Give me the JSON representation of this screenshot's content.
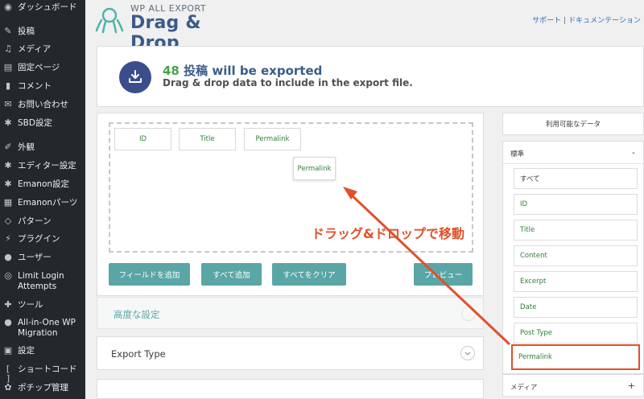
{
  "sidebar": {
    "items": [
      {
        "icon": "dashboard-icon",
        "glyph": "◉",
        "label": "ダッシュボード"
      },
      {
        "icon": "pin-icon",
        "glyph": "✎",
        "label": "投稿"
      },
      {
        "icon": "media-icon",
        "glyph": "♫",
        "label": "メディア"
      },
      {
        "icon": "page-icon",
        "glyph": "▤",
        "label": "固定ページ"
      },
      {
        "icon": "comment-icon",
        "glyph": "▮",
        "label": "コメント"
      },
      {
        "icon": "mail-icon",
        "glyph": "✉",
        "label": "お問い合わせ"
      },
      {
        "icon": "gear-icon",
        "glyph": "✱",
        "label": "SBD設定"
      },
      {
        "icon": "brush-icon",
        "glyph": "✐",
        "label": "外観"
      },
      {
        "icon": "gear-icon",
        "glyph": "✱",
        "label": "エディター設定"
      },
      {
        "icon": "gear-icon",
        "glyph": "✱",
        "label": "Emanon設定"
      },
      {
        "icon": "grid-icon",
        "glyph": "▦",
        "label": "Emanonパーツ"
      },
      {
        "icon": "pattern-icon",
        "glyph": "◇",
        "label": "パターン"
      },
      {
        "icon": "plugin-icon",
        "glyph": "⚡",
        "label": "プラグイン"
      },
      {
        "icon": "user-icon",
        "glyph": "●",
        "label": "ユーザー"
      },
      {
        "icon": "fingerprint-icon",
        "glyph": "◎",
        "label": "Limit Login Attempts"
      },
      {
        "icon": "wrench-icon",
        "glyph": "✚",
        "label": "ツール"
      },
      {
        "icon": "migration-icon",
        "glyph": "●",
        "label": "All-in-One WP Migration"
      },
      {
        "icon": "settings-icon",
        "glyph": "▣",
        "label": "設定"
      },
      {
        "icon": "shortcode-icon",
        "glyph": "[ ]",
        "label": "ショートコード"
      },
      {
        "icon": "paw-icon",
        "glyph": "✿",
        "label": "ポチップ管理"
      }
    ]
  },
  "header": {
    "brand_small": "WP ALL EXPORT",
    "brand_big": "Drag & Drop",
    "link_support": "サポート",
    "separator": "|",
    "link_docs": "ドキュメンテーション"
  },
  "summary": {
    "count": "48",
    "post_type": "投稿",
    "will_be_exported": "will be exported",
    "subtitle": "Drag & drop data to include in the export file."
  },
  "dropzone": {
    "fields": [
      "ID",
      "Title",
      "Permalink"
    ],
    "dragging": "Permalink"
  },
  "buttons": {
    "add_field": "フィールドを追加",
    "add_all": "すべて追加",
    "clear_all": "すべてをクリア",
    "preview": "プレビュー"
  },
  "advanced": {
    "label": "高度な設定"
  },
  "export_type": {
    "label": "Export Type"
  },
  "available": {
    "heading": "利用可能なデータ",
    "section_standard": "標準",
    "standard_toggle": "-",
    "items": [
      "すべて",
      "ID",
      "Title",
      "Content",
      "Excerpt",
      "Date",
      "Post Type",
      "Permalink"
    ],
    "section_media": "メディア",
    "media_toggle": "+"
  },
  "annotation": {
    "text": "ドラッグ&ドロップで移動",
    "color": "#e0502a"
  },
  "colors": {
    "sidebar_bg": "#23282d",
    "accent_teal": "#5aa6a6",
    "brand_blue": "#3b5b8a",
    "count_green": "#46a34b"
  }
}
